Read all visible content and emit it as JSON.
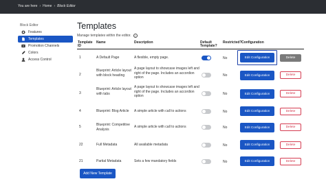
{
  "breadcrumb": [
    "You are here",
    "Home",
    "Block Editor"
  ],
  "sidebar": {
    "title": "Block Editor",
    "items": [
      {
        "label": "Features",
        "icon": "gear-icon",
        "active": false
      },
      {
        "label": "Templates",
        "icon": "document-icon",
        "active": true
      },
      {
        "label": "Promotion Channels",
        "icon": "play-icon",
        "active": false
      },
      {
        "label": "Colors",
        "icon": "pencil-icon",
        "active": false
      },
      {
        "label": "Access Control",
        "icon": "user-icon",
        "active": false
      }
    ]
  },
  "main": {
    "title": "Templates",
    "description": "Manage templates within the editor.",
    "columns": {
      "id": "Template ID",
      "name": "Name",
      "description": "Description",
      "default": "Default Template?",
      "restricted": "Restricted?",
      "configuration": "Configuration"
    },
    "edit_label": "Edit Configuration",
    "delete_label": "Delete",
    "rows": [
      {
        "id": "1",
        "name": "A Default Page",
        "description": "A flexible, empty page.",
        "default": true,
        "restricted": "No",
        "delete_disabled": true
      },
      {
        "id": "2",
        "name": "Blueprint: Article layout with block heading",
        "description": "A page layout to showcase images left and right of the page. Includes an accordion option",
        "default": false,
        "restricted": "No",
        "delete_disabled": false
      },
      {
        "id": "3",
        "name": "Blueprint: Article layout with tabs",
        "description": "A page layout to showcase images left and right of the page. Includes an accordion option",
        "default": false,
        "restricted": "No",
        "delete_disabled": false
      },
      {
        "id": "4",
        "name": "Blueprint: Blog Article",
        "description": "A simple article with call to actions",
        "default": false,
        "restricted": "No",
        "delete_disabled": false
      },
      {
        "id": "5",
        "name": "Blueprint: Competitive Analysis",
        "description": "A simple article with call to actions",
        "default": false,
        "restricted": "No",
        "delete_disabled": false
      },
      {
        "id": "22",
        "name": "Full Metadata",
        "description": "All available metadata",
        "default": false,
        "restricted": "No",
        "delete_disabled": false
      },
      {
        "id": "21",
        "name": "Partial Metadata",
        "description": "Sets a few mandatory fields",
        "default": false,
        "restricted": "No",
        "delete_disabled": false
      }
    ],
    "add_label": "Add New Template"
  },
  "colors": {
    "topbar": "#2b2e33",
    "primary": "#1a56c4",
    "danger": "#d43a4f",
    "disabled": "#7a7a7a"
  }
}
